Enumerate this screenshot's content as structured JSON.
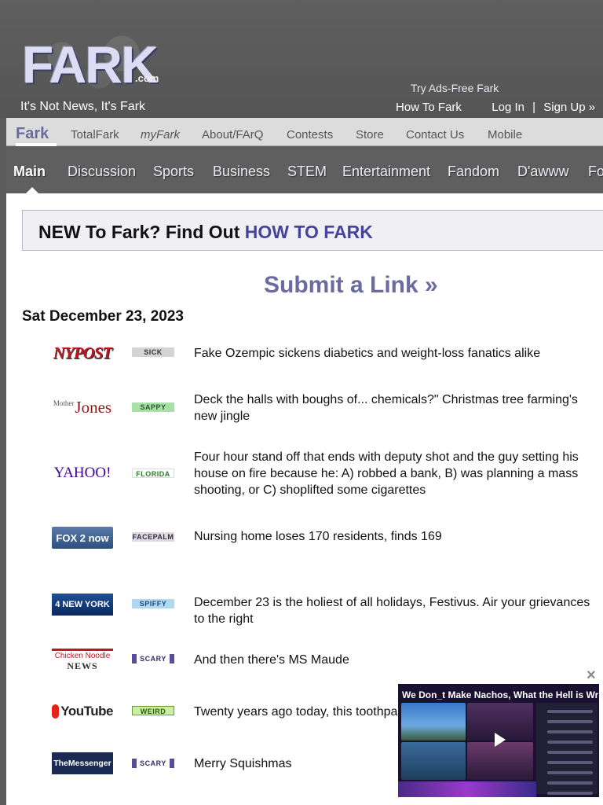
{
  "header": {
    "logo_text": "FARK",
    "logo_suffix": ".com",
    "tagline": "It's Not News, It's Fark",
    "ads_free": "Try Ads-Free Fark",
    "links": {
      "how_to": "How To Fark",
      "login": "Log In",
      "separator": "|",
      "signup": "Sign Up »"
    }
  },
  "subnav": {
    "items": [
      "Fark",
      "TotalFark",
      "myFark",
      "About/FArQ",
      "Contests",
      "Store",
      "Contact Us",
      "Mobile"
    ]
  },
  "mainnav": {
    "tabs": [
      "Main",
      "Discussion",
      "Sports",
      "Business",
      "STEM",
      "Entertainment",
      "Fandom",
      "D'awww",
      "Fo"
    ]
  },
  "newbox": {
    "text": "NEW To Fark? Find Out ",
    "highlight": "HOW TO FARK"
  },
  "submit": "Submit a Link »",
  "date": "Sat December 23, 2023",
  "stories": [
    {
      "source": "NYPOST",
      "tag": "SICK",
      "headline": "Fake Ozempic sickens diabetics and weight-loss fanatics alike"
    },
    {
      "source": "Jones",
      "source_prefix": "Mother",
      "tag": "SAPPY",
      "headline": "Deck the halls with boughs of... chemicals?\" Christmas tree farming's new jingle"
    },
    {
      "source": "YAHOO!",
      "tag": "FLORIDA",
      "headline": "Four hour stand off that ends with deputy shot and the guy setting his house on fire because he: A) robbed a bank, B) was planning a mass shooting, or C) shoplifted some cigarettes"
    },
    {
      "source": "FOX 2 now",
      "tag": "FACEPALM",
      "headline": "Nursing home loses 170 residents, finds 169"
    },
    {
      "source": "4 NEW YORK",
      "tag": "SPIFFY",
      "headline": "December 23 is the holiest of all holidays, Festivus. Air your grievances to the right"
    },
    {
      "source": "Chicken Noodle",
      "source_sub": "NEWS",
      "tag": "SCARY",
      "headline": "And then there's MS Maude"
    },
    {
      "source": "YouTube",
      "tag": "WEIRD",
      "headline": "Twenty years ago today, this toothpa"
    },
    {
      "source": "TheMessenger",
      "tag": "SCARY",
      "headline": "Merry Squishmas"
    }
  ],
  "tag_colors": {
    "SICK": "#d4d4d4",
    "SAPPY": "#a8e0a8",
    "FLORIDA": "#ffffff",
    "FACEPALM": "#e0d8e8",
    "SPIFFY": "#b0d8f0",
    "SCARY": "#ffffff",
    "WEIRD": "#c8f0a0"
  },
  "video": {
    "title": "We Don_t Make Nachos, What the Hell is Wrong",
    "close": "×"
  }
}
